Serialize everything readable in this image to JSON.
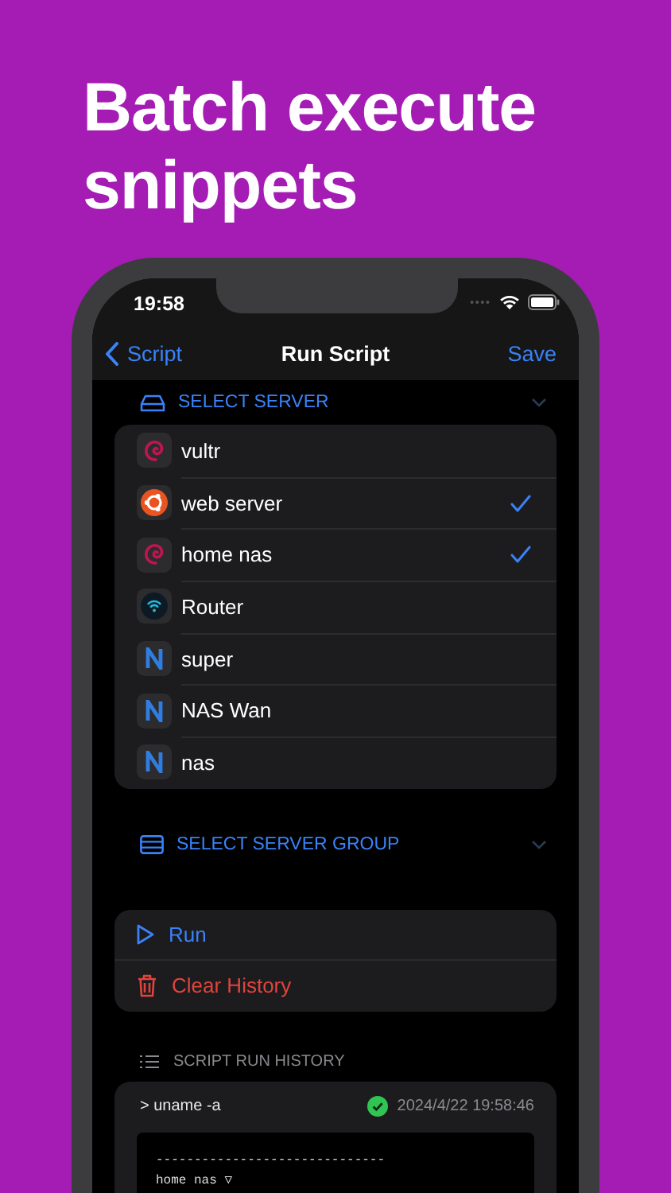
{
  "headline": "Batch execute snippets",
  "status_bar": {
    "time": "19:58"
  },
  "nav": {
    "back": "Script",
    "title": "Run Script",
    "action": "Save"
  },
  "server_section": {
    "title": "SELECT SERVER",
    "expanded": true
  },
  "servers": [
    {
      "name": "vultr",
      "kind": "debian",
      "checked": false
    },
    {
      "name": "web server",
      "kind": "ubuntu",
      "checked": true
    },
    {
      "name": "home nas",
      "kind": "debian",
      "checked": true
    },
    {
      "name": "Router",
      "kind": "router",
      "checked": false
    },
    {
      "name": "super",
      "kind": "n",
      "checked": false
    },
    {
      "name": "NAS Wan",
      "kind": "n",
      "checked": false
    },
    {
      "name": "nas",
      "kind": "n",
      "checked": false
    }
  ],
  "group_section": {
    "title": "SELECT SERVER GROUP"
  },
  "actions": [
    {
      "label": "Run",
      "kind": "run"
    },
    {
      "label": "Clear History",
      "kind": "clear"
    }
  ],
  "history": {
    "title": "SCRIPT RUN HISTORY",
    "entries": [
      {
        "command": "> uname -a",
        "success": true,
        "time": "2024/4/22 19:58:46",
        "output": [
          "------------------------------",
          "home nas ▽"
        ]
      }
    ]
  }
}
